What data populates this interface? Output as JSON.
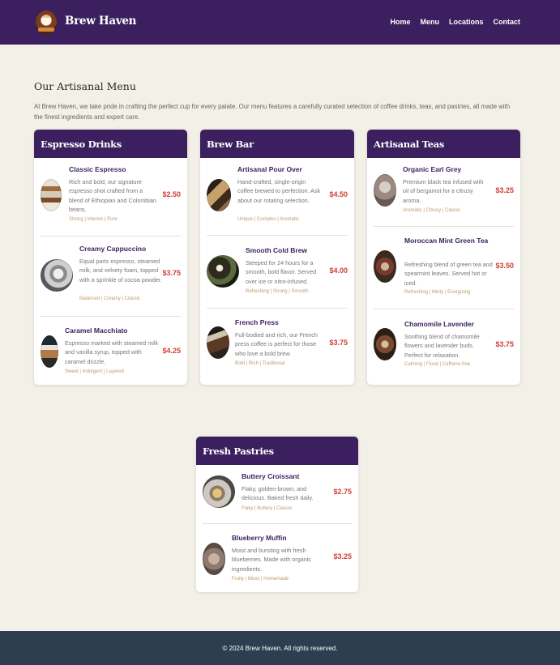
{
  "header": {
    "brand": "Brew Haven",
    "nav": [
      "Home",
      "Menu",
      "Locations",
      "Contact"
    ]
  },
  "page": {
    "title": "Our Artisanal Menu",
    "intro": "At Brew Haven, we take pride in crafting the perfect cup for every palate. Our menu features a carefully curated selection of coffee drinks, teas, and pastries, all made with the finest ingredients and expert care."
  },
  "categories": [
    {
      "title": "Espresso Drinks",
      "items": [
        {
          "name": "Classic Espresso",
          "desc": "Rich and bold, our signature espresso shot crafted from a blend of Ethiopian and Colombian beans.",
          "tags": "Strong | Intense | Pure",
          "price": "$2.50"
        },
        {
          "name": "Creamy Cappuccino",
          "desc": "Equal parts espresso, steamed milk, and velvety foam, topped with a sprinkle of cocoa powder.",
          "tags": "Balanced | Creamy | Classic",
          "price": "$3.75"
        },
        {
          "name": "Caramel Macchiato",
          "desc": "Espresso marked with steamed milk and vanilla syrup, topped with caramel drizzle.",
          "tags": "Sweet | Indulgent | Layered",
          "price": "$4.25"
        }
      ]
    },
    {
      "title": "Brew Bar",
      "items": [
        {
          "name": "Artisanal Pour Over",
          "desc": "Hand-crafted, single-origin coffee brewed to perfection. Ask about our rotating selection.",
          "tags": "Unique | Complex | Aromatic",
          "price": "$4.50"
        },
        {
          "name": "Smooth Cold Brew",
          "desc": "Steeped for 24 hours for a smooth, bold flavor. Served over ice or nitro-infused.",
          "tags": "Refreshing | Strong | Smooth",
          "price": "$4.00"
        },
        {
          "name": "French Press",
          "desc": "Full-bodied and rich, our French press coffee is perfect for those who love a bold brew.",
          "tags": "Bold | Rich | Traditional",
          "price": "$3.75"
        }
      ]
    },
    {
      "title": "Artisanal Teas",
      "items": [
        {
          "name": "Organic Earl Grey",
          "desc": "Premium black tea infused with oil of bergamot for a citrusy aroma.",
          "tags": "Aromatic | Citrusy | Classic",
          "price": "$3.25"
        },
        {
          "name": "Moroccan Mint Green Tea",
          "desc": "Refreshing blend of green tea and spearmint leaves. Served hot or iced.",
          "tags": "Refreshing | Minty | Energizing",
          "price": "$3.50"
        },
        {
          "name": "Chamomile Lavender",
          "desc": "Soothing blend of chamomile flowers and lavender buds. Perfect for relaxation.",
          "tags": "Calming | Floral | Caffeine-free",
          "price": "$3.75"
        }
      ]
    },
    {
      "title": "Fresh Pastries",
      "items": [
        {
          "name": "Buttery Croissant",
          "desc": "Flaky, golden-brown, and delicious. Baked fresh daily.",
          "tags": "Flaky | Buttery | Classic",
          "price": "$2.75"
        },
        {
          "name": "Blueberry Muffin",
          "desc": "Moist and bursting with fresh blueberries. Made with organic ingredients.",
          "tags": "Fruity | Moist | Homemade",
          "price": "$3.25"
        }
      ]
    }
  ],
  "footer": {
    "text": "© 2024 Brew Haven. All rights reserved."
  }
}
